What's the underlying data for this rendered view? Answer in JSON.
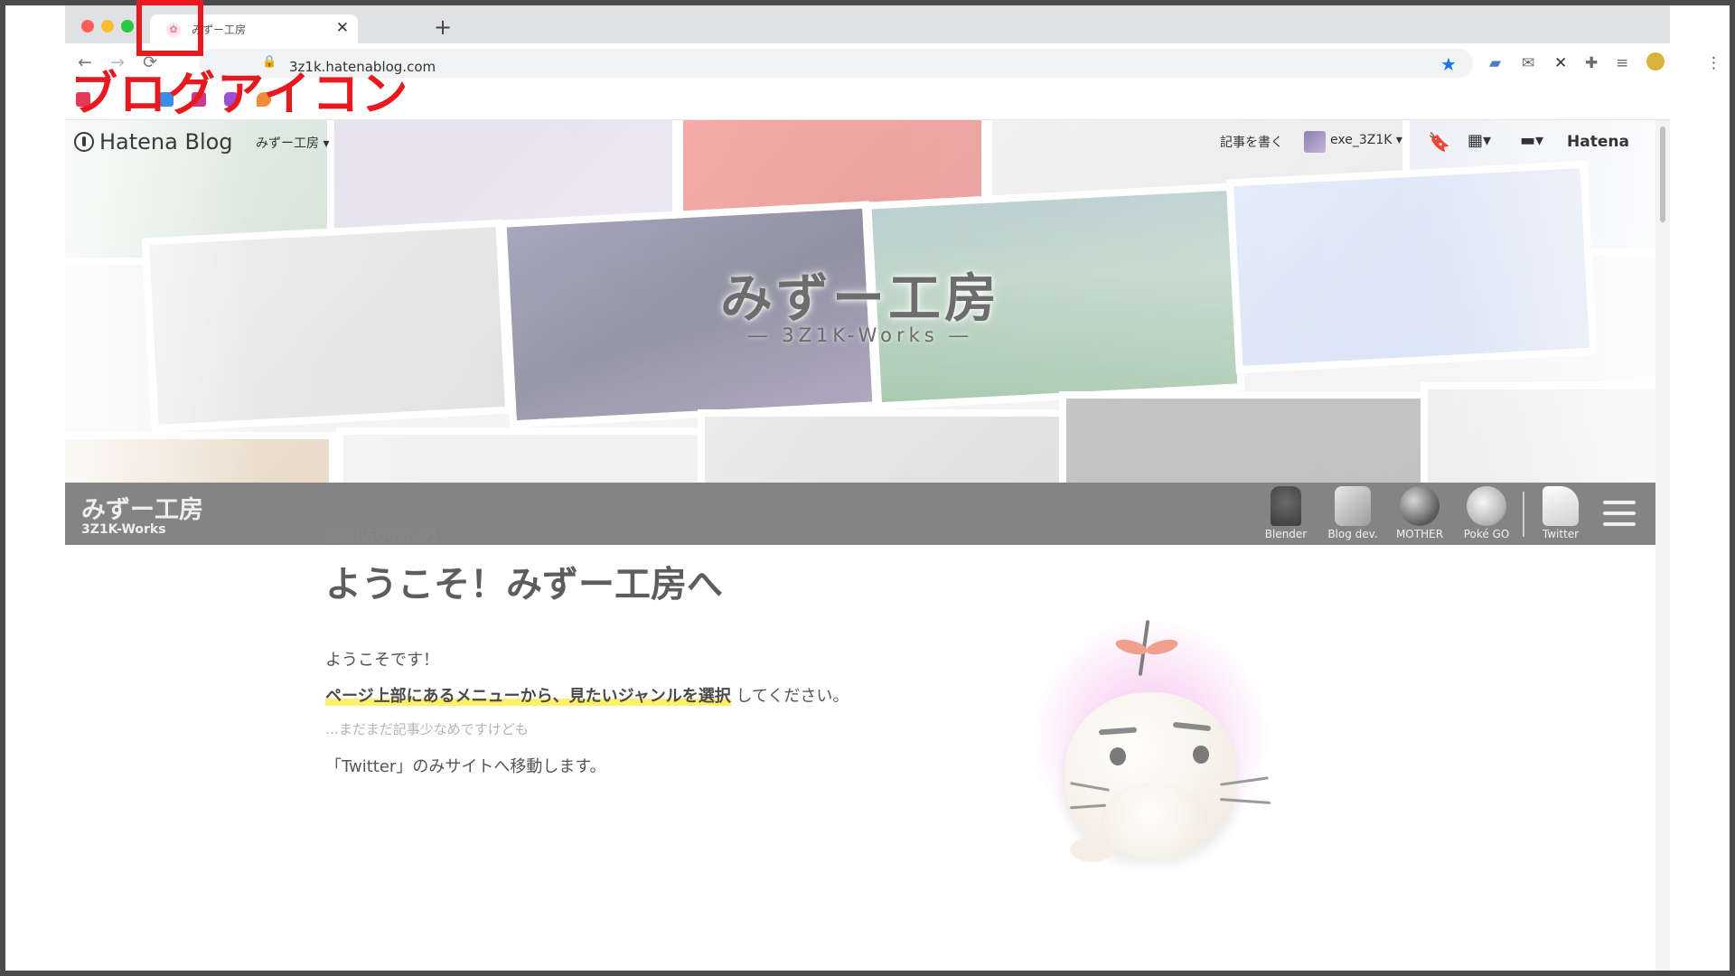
{
  "browser": {
    "tab_title": "みずー工房",
    "tab_close": "✕",
    "new_tab": "+",
    "url": "3z1k.hatenablog.com",
    "nav": {
      "back": "←",
      "forward": "→",
      "reload": "⟳",
      "lock": "🔒"
    },
    "extensions": [
      "star-icon",
      "chat-icon",
      "mail-icon",
      "tool-icon",
      "puzzle-icon",
      "playlist-icon",
      "profile-icon",
      "more-icon"
    ]
  },
  "annotation": {
    "label": "ブログアイコン",
    "color": "#e8191e"
  },
  "hatena_bar": {
    "logo": "Hatena Blog",
    "blog_menu": "みずー工房 ▾",
    "write": "記事を書く",
    "user": "exe_3Z1K ▾",
    "hatena": "Hatena"
  },
  "hero": {
    "title": "みずー工房",
    "subtitle": "― 3Z1K-Works ―"
  },
  "site_header": {
    "title": "みずー工房",
    "subtitle": "3Z1K-Works",
    "nav": [
      {
        "label": "Blender",
        "icon": "lantern-icon"
      },
      {
        "label": "Blog dev.",
        "icon": "pen-icon"
      },
      {
        "label": "MOTHER",
        "icon": "globe-icon"
      },
      {
        "label": "Poké GO",
        "icon": "pokeball-icon"
      },
      {
        "label": "Twitter",
        "icon": "quill-icon"
      }
    ]
  },
  "post": {
    "date": "2050-01-01",
    "title": "ようこそ！みずー工房へ",
    "p1": "ようこそです！",
    "p2_highlight": "ページ上部にあるメニューから、見たいジャンルを選択",
    "p2_rest": "してください。",
    "p3": "…まだまだ記事少なめですけども",
    "p4": "「Twitter」のみサイトへ移動します。"
  },
  "colors": {
    "site_bar": "#848484",
    "highlight": "#fff06a",
    "annotation": "#e8191e"
  }
}
